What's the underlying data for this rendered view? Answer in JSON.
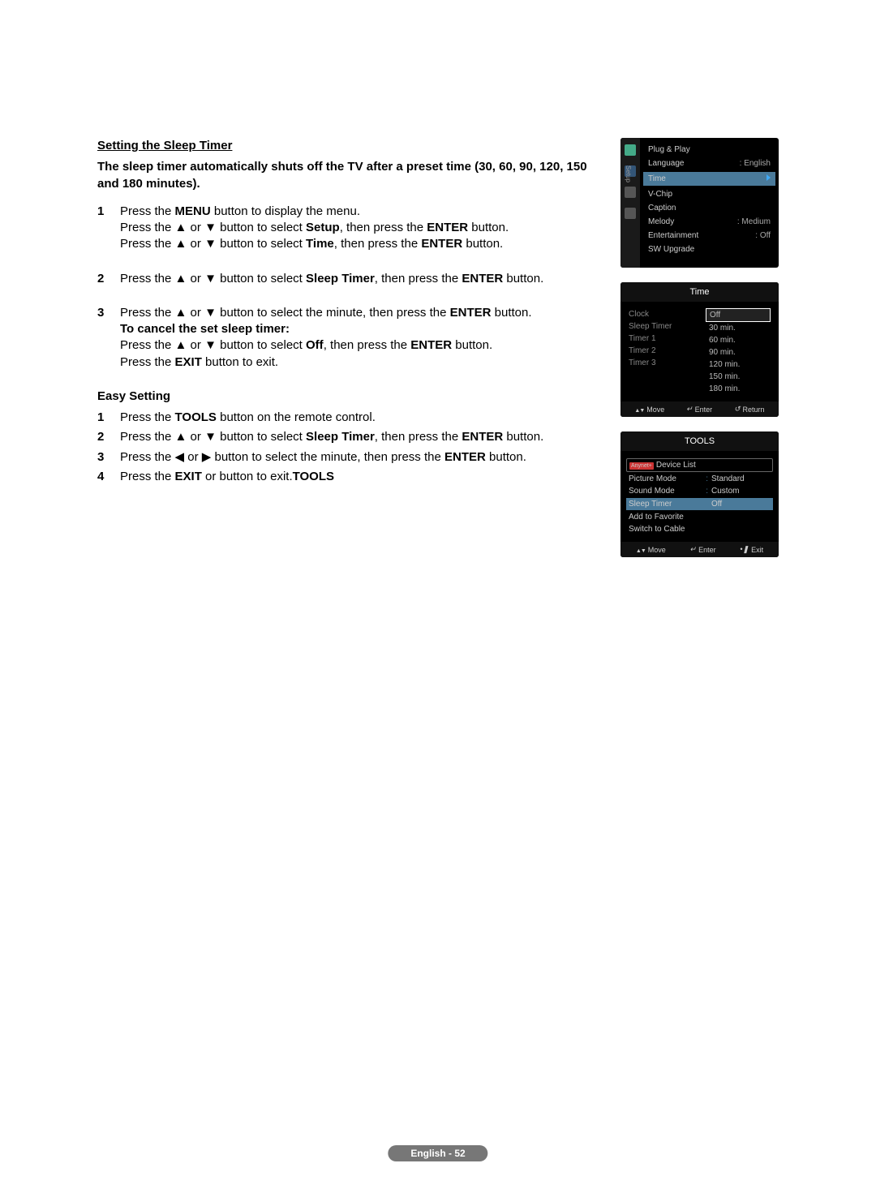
{
  "heading": "Setting the Sleep Timer",
  "intro": "The sleep timer automatically shuts off the TV after a preset time (30, 60, 90, 120, 150 and 180 minutes).",
  "steps": [
    {
      "num": "1",
      "parts": [
        {
          "pre": "Press the ",
          "b": "MENU",
          "post": " button to display the menu."
        },
        {
          "pre": "Press the ",
          "sym": "updn",
          "mid": " button to select ",
          "b": "Setup",
          "post2": ", then press the ",
          "b2": "ENTER",
          "post3": " button."
        },
        {
          "pre": "Press the ",
          "sym": "updn",
          "mid": " button to select ",
          "b": "Time",
          "post2": ", then press the ",
          "b2": "ENTER",
          "post3": " button."
        }
      ]
    },
    {
      "num": "2",
      "parts": [
        {
          "pre": "Press the ",
          "sym": "updn",
          "mid": " button to select ",
          "b": "Sleep Timer",
          "post2": ", then press the ",
          "b2": "ENTER",
          "post3": " button."
        }
      ]
    },
    {
      "num": "3",
      "parts": [
        {
          "pre": "Press the ",
          "sym": "updn",
          "mid": " button to select the minute, then press the ",
          "b": "ENTER",
          "post2": " button."
        },
        {
          "b_line": "To cancel the set sleep timer:"
        },
        {
          "pre": "Press the ",
          "sym": "updn",
          "mid": " button to select ",
          "b": "Off",
          "post2": ", then press the ",
          "b2": "ENTER",
          "post3": " button."
        },
        {
          "pre": "Press the ",
          "b": "EXIT",
          "post": " button to exit."
        }
      ]
    }
  ],
  "easy_heading": "Easy Setting",
  "easy_steps": [
    {
      "num": "1",
      "pre": "Press the ",
      "b": "TOOLS",
      "post": " button on the remote control."
    },
    {
      "num": "2",
      "pre": "Press the ",
      "sym": "updn",
      "mid": " button to select ",
      "b": "Sleep Timer",
      "post2": ", then press the ",
      "b2": "ENTER",
      "post3": " button."
    },
    {
      "num": "3",
      "pre": "Press the ",
      "sym": "lfrt",
      "mid": " button to select the minute, then press the ",
      "b": "ENTER",
      "post2": " button."
    },
    {
      "num": "4",
      "pre": "Press the ",
      "b": "EXIT",
      "mid2": " or ",
      "b2": "TOOLS",
      "post": " button to exit."
    }
  ],
  "ss1": {
    "tab_label": "Setup",
    "items": [
      {
        "label": "Plug & Play",
        "val": ""
      },
      {
        "label": "Language",
        "val": ": English"
      },
      {
        "label": "Time",
        "val": "",
        "highlight": true
      },
      {
        "label": "V-Chip",
        "val": ""
      },
      {
        "label": "Caption",
        "val": ""
      },
      {
        "label": "Melody",
        "val": ": Medium"
      },
      {
        "label": "Entertainment",
        "val": ": Off"
      },
      {
        "label": "SW Upgrade",
        "val": ""
      }
    ]
  },
  "ss2": {
    "title": "Time",
    "left": [
      "Clock",
      "Sleep Timer",
      "Timer 1",
      "Timer 2",
      "Timer 3"
    ],
    "options": [
      "Off",
      "30 min.",
      "60 min.",
      "90 min.",
      "120 min.",
      "150 min.",
      "180 min."
    ],
    "selected": "Off",
    "footer": {
      "move": "Move",
      "enter": "Enter",
      "return": "Return"
    }
  },
  "ss3": {
    "title": "TOOLS",
    "rows": [
      {
        "label": "Device List",
        "val": "",
        "anynet": true,
        "box": true
      },
      {
        "label": "Picture Mode",
        "val": "Standard"
      },
      {
        "label": "Sound Mode",
        "val": "Custom"
      },
      {
        "label": "Sleep Timer",
        "val": "Off",
        "highlight": true
      },
      {
        "label": "Add to Favorite",
        "val": ""
      },
      {
        "label": "Switch to Cable",
        "val": ""
      }
    ],
    "footer": {
      "move": "Move",
      "enter": "Enter",
      "exit": "Exit"
    }
  },
  "footer": "English - 52"
}
